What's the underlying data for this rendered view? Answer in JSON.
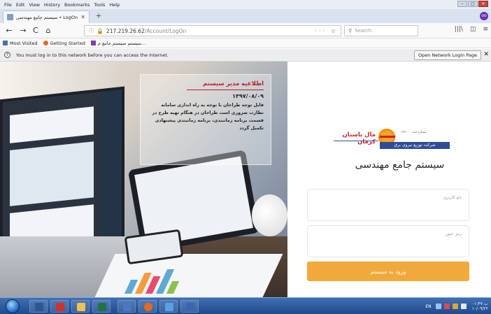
{
  "menubar": {
    "items": [
      "File",
      "Edit",
      "View",
      "History",
      "Bookmarks",
      "Tools",
      "Help"
    ]
  },
  "window": {
    "minimize": "–",
    "maximize": "□",
    "close": "✕"
  },
  "tab": {
    "title": "سیستم جامع مهندسی • LogOn",
    "close": "✕",
    "new_tab": "+"
  },
  "profile": {
    "label": "oo"
  },
  "nav": {
    "back": "←",
    "forward": "→",
    "reload": "C",
    "home": "⌂",
    "url_host": "217.219.26.62",
    "url_path": "/Account/LogOn",
    "url_actions": "··· ☆",
    "search_placeholder": "Search",
    "library": "|||\\",
    "sidebar": "◫",
    "menu": "≡"
  },
  "bookmarks": [
    {
      "label": "Most Visited",
      "color": "#4a6fb3"
    },
    {
      "label": "Getting Started",
      "color": "#e56a1e"
    },
    {
      "label": "سیستم سیستم جامع م...",
      "color": "#7b3fb0"
    }
  ],
  "notification": {
    "info": "?",
    "text": "You must log in to this network before you can access the Internet.",
    "button": "Open Network Login Page",
    "close": "✕"
  },
  "notice": {
    "title": "اطلاعیه مدیر سیستم",
    "date": "۱۳۹۷/۰۸/۰۹",
    "body": "قابل توجه طراحان با توجه به راه اندازی سامانه نظارت ضروری است طراحان در هنگام تهیه طرح در قسمت برنامه زمانبندی، برنامه زمانبندی پیشنهادی تکمیل گردد"
  },
  "logo": {
    "name": "مال باستان کرمان",
    "company": "شرکت توزیع نیروی برق",
    "reg": "شماره ثبت ۱۳۶۰۰۰"
  },
  "login": {
    "system_title": "سیستم جامع مهندسی",
    "username_label": "نام کاربری",
    "password_label": "رمز عبور",
    "submit": "ورود به سیستم"
  },
  "taskbar": {
    "lang": "EN",
    "time": "۰۱:۴۷ ب",
    "date": "۱۰/۰۹/۲۲"
  }
}
